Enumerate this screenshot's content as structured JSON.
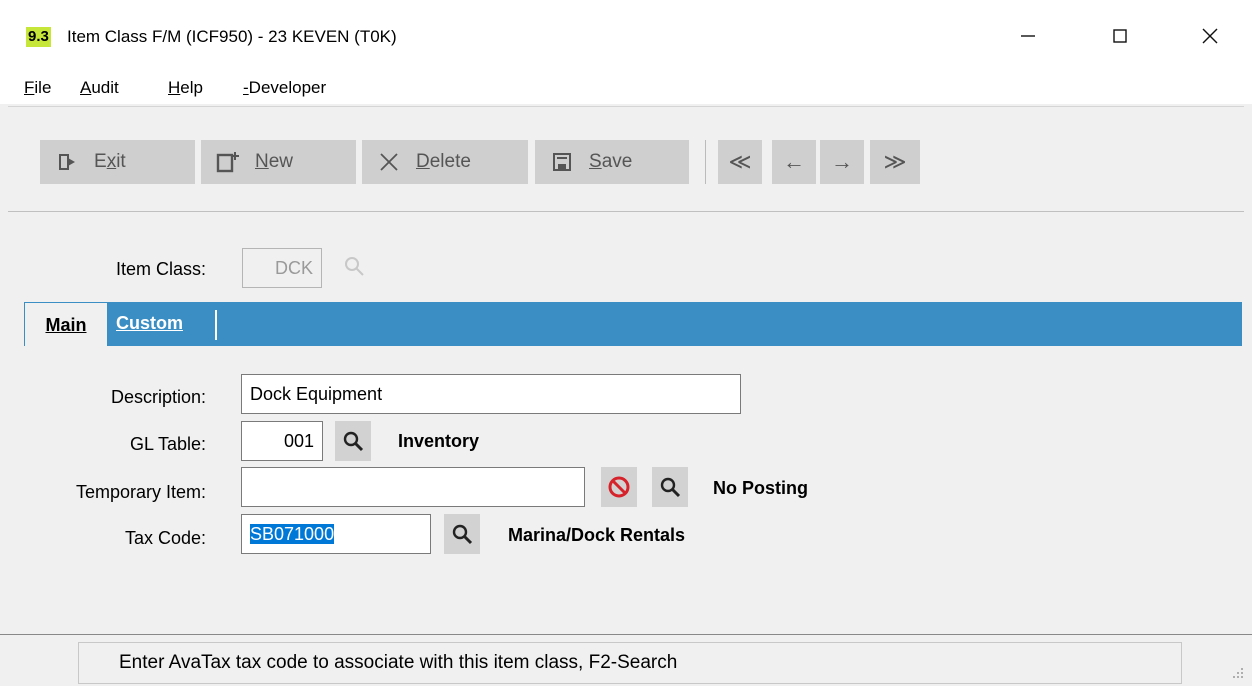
{
  "window": {
    "badge": "9.3",
    "title": "Item Class F/M (ICF950) - 23 KEVEN (T0K)"
  },
  "menu": {
    "file": {
      "hot": "F",
      "rest": "ile"
    },
    "audit": {
      "hot": "A",
      "rest": "udit"
    },
    "help": {
      "hot": "H",
      "rest": "elp"
    },
    "developer": {
      "hot": "-",
      "rest": "Developer"
    }
  },
  "toolbar": {
    "exit": {
      "pre": "E",
      "hot": "x",
      "post": "it"
    },
    "new": {
      "pre": "",
      "hot": "N",
      "post": "ew"
    },
    "delete": {
      "pre": "",
      "hot": "D",
      "post": "elete"
    },
    "save": {
      "pre": "",
      "hot": "S",
      "post": "ave"
    },
    "nav_first": "≪",
    "nav_prev": "←",
    "nav_next": "→",
    "nav_last": "≫"
  },
  "form": {
    "item_class_label": "Item Class:",
    "item_class_value": "DCK",
    "tabs": {
      "main": "Main",
      "custom": {
        "hot": "C",
        "rest": "ustom"
      }
    },
    "description_label": "Description:",
    "description_value": "Dock Equipment",
    "gl_table_label": "GL Table:",
    "gl_table_value": "001",
    "gl_table_desc": "Inventory",
    "temporary_item_label": "Temporary Item:",
    "temporary_item_value": "",
    "temporary_item_desc": "No Posting",
    "tax_code_label": "Tax Code:",
    "tax_code_value": "SB071000",
    "tax_code_desc": "Marina/Dock Rentals"
  },
  "status": {
    "message": "Enter AvaTax tax code to associate with this item class, F2-Search"
  },
  "colors": {
    "tab_strip": "#3b8ec4",
    "badge": "#c6e73a",
    "selection": "#0078d7",
    "no_entry_red": "#d6232b"
  }
}
